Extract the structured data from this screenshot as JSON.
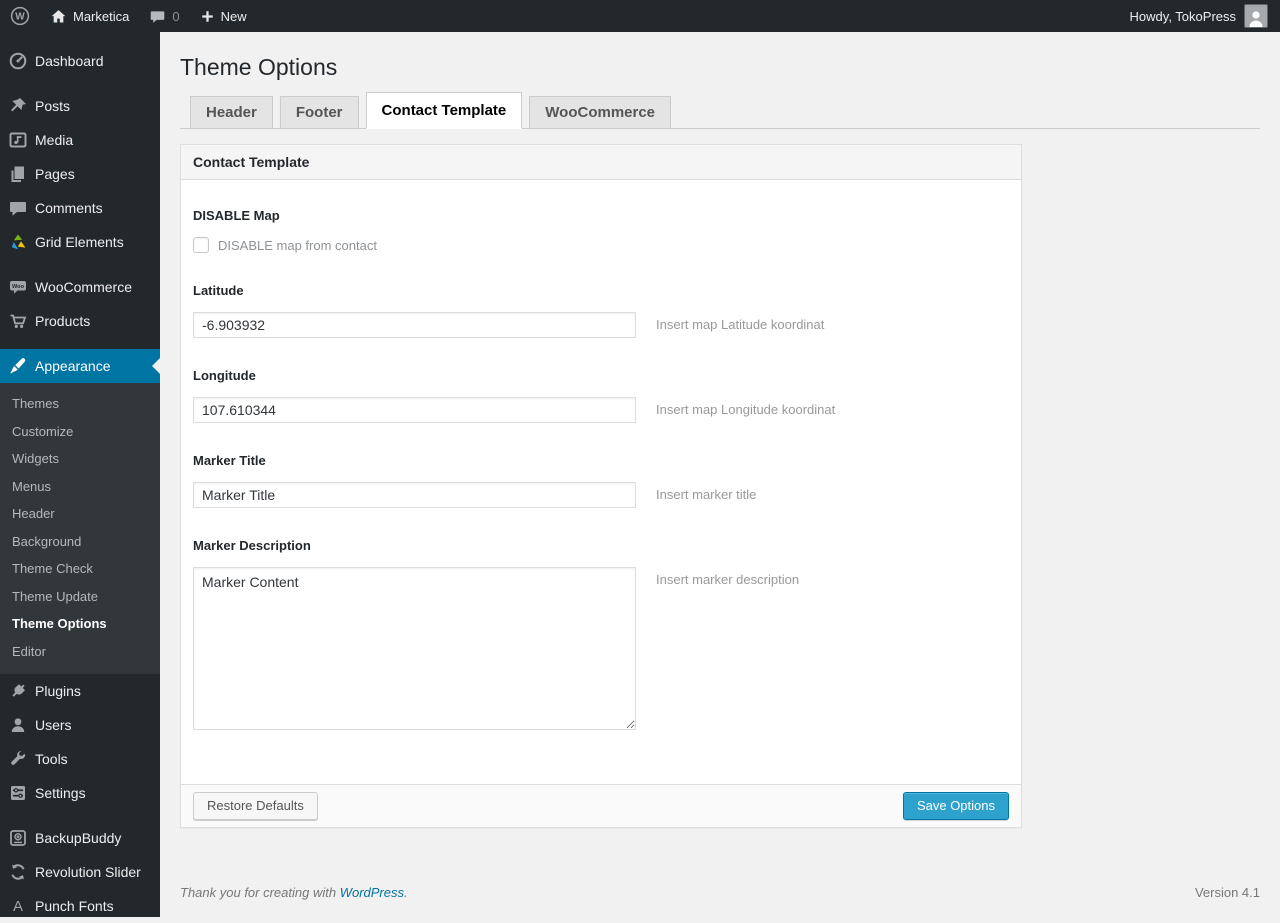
{
  "admin_bar": {
    "site_name": "Marketica",
    "comment_count": "0",
    "new_label": "New",
    "howdy": "Howdy, TokoPress"
  },
  "sidebar": {
    "items": [
      {
        "label": "Dashboard",
        "icon": "dashboard-icon"
      },
      {
        "label": "Posts",
        "icon": "pin-icon"
      },
      {
        "label": "Media",
        "icon": "media-icon"
      },
      {
        "label": "Pages",
        "icon": "pages-icon"
      },
      {
        "label": "Comments",
        "icon": "comments-icon"
      },
      {
        "label": "Grid Elements",
        "icon": "grid-elements-icon"
      },
      {
        "label": "WooCommerce",
        "icon": "woocommerce-icon"
      },
      {
        "label": "Products",
        "icon": "cart-icon"
      },
      {
        "label": "Appearance",
        "icon": "brush-icon",
        "active": true
      },
      {
        "label": "Plugins",
        "icon": "plug-icon"
      },
      {
        "label": "Users",
        "icon": "user-icon"
      },
      {
        "label": "Tools",
        "icon": "wrench-icon"
      },
      {
        "label": "Settings",
        "icon": "sliders-icon"
      },
      {
        "label": "BackupBuddy",
        "icon": "backup-icon"
      },
      {
        "label": "Revolution Slider",
        "icon": "refresh-icon"
      },
      {
        "label": "Punch Fonts",
        "icon": "letter-a-icon"
      }
    ],
    "appearance_submenu": [
      {
        "label": "Themes"
      },
      {
        "label": "Customize"
      },
      {
        "label": "Widgets"
      },
      {
        "label": "Menus"
      },
      {
        "label": "Header"
      },
      {
        "label": "Background"
      },
      {
        "label": "Theme Check"
      },
      {
        "label": "Theme Update"
      },
      {
        "label": "Theme Options",
        "current": true
      },
      {
        "label": "Editor"
      }
    ]
  },
  "main": {
    "page_title": "Theme Options",
    "tabs": [
      {
        "label": "Header",
        "active": false
      },
      {
        "label": "Footer",
        "active": false
      },
      {
        "label": "Contact Template",
        "active": true
      },
      {
        "label": "WooCommerce",
        "active": false
      }
    ],
    "panel": {
      "title": "Contact Template",
      "fields": {
        "disable_map": {
          "label": "DISABLE Map",
          "checkbox_label": "DISABLE map from contact",
          "checked": false
        },
        "latitude": {
          "label": "Latitude",
          "value": "-6.903932",
          "helper": "Insert map Latitude koordinat"
        },
        "longitude": {
          "label": "Longitude",
          "value": "107.610344",
          "helper": "Insert map Longitude koordinat"
        },
        "marker_title": {
          "label": "Marker Title",
          "value": "Marker Title",
          "helper": "Insert marker title"
        },
        "marker_description": {
          "label": "Marker Description",
          "value": "Marker Content",
          "helper": "Insert marker description"
        }
      },
      "restore_button": "Restore Defaults",
      "save_button": "Save Options"
    }
  },
  "footer": {
    "thanks_prefix": "Thank you for creating with ",
    "link_text": "WordPress",
    "thanks_suffix": ".",
    "version": "Version 4.1"
  },
  "colors": {
    "accent": "#0074a2",
    "primary_button": "#2ea2cc",
    "admin_bar": "#23282d",
    "submenu_bg": "#32373c",
    "content_bg": "#f1f1f1"
  }
}
